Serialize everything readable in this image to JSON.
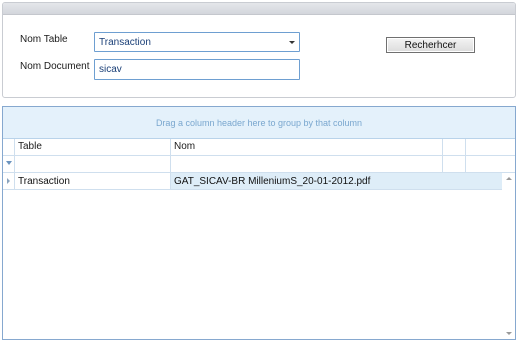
{
  "search": {
    "table_label": "Nom Table",
    "table_value": "Transaction",
    "document_label": "Nom Document",
    "document_value": "sicav",
    "search_button": "Recherhcer"
  },
  "grid": {
    "group_hint": "Drag a column header here to group by that column",
    "columns": [
      "Table",
      "Nom"
    ],
    "rows": [
      {
        "table": "Transaction",
        "nom": "GAT_SICAV-BR MilleniumS_20-01-2012.pdf"
      }
    ]
  },
  "icons": {
    "combo_arrow": "chevron-down-icon",
    "filter": "filter-icon",
    "row_indicator": "row-indicator-icon",
    "scroll_up": "scroll-up-icon",
    "scroll_down": "scroll-down-icon"
  },
  "colors": {
    "input_border": "#6e9fd1",
    "input_text": "#1a3f77",
    "group_panel_bg": "#e4f1fb",
    "group_panel_text": "#7aa7cf",
    "selected_row": "#deedf8"
  }
}
